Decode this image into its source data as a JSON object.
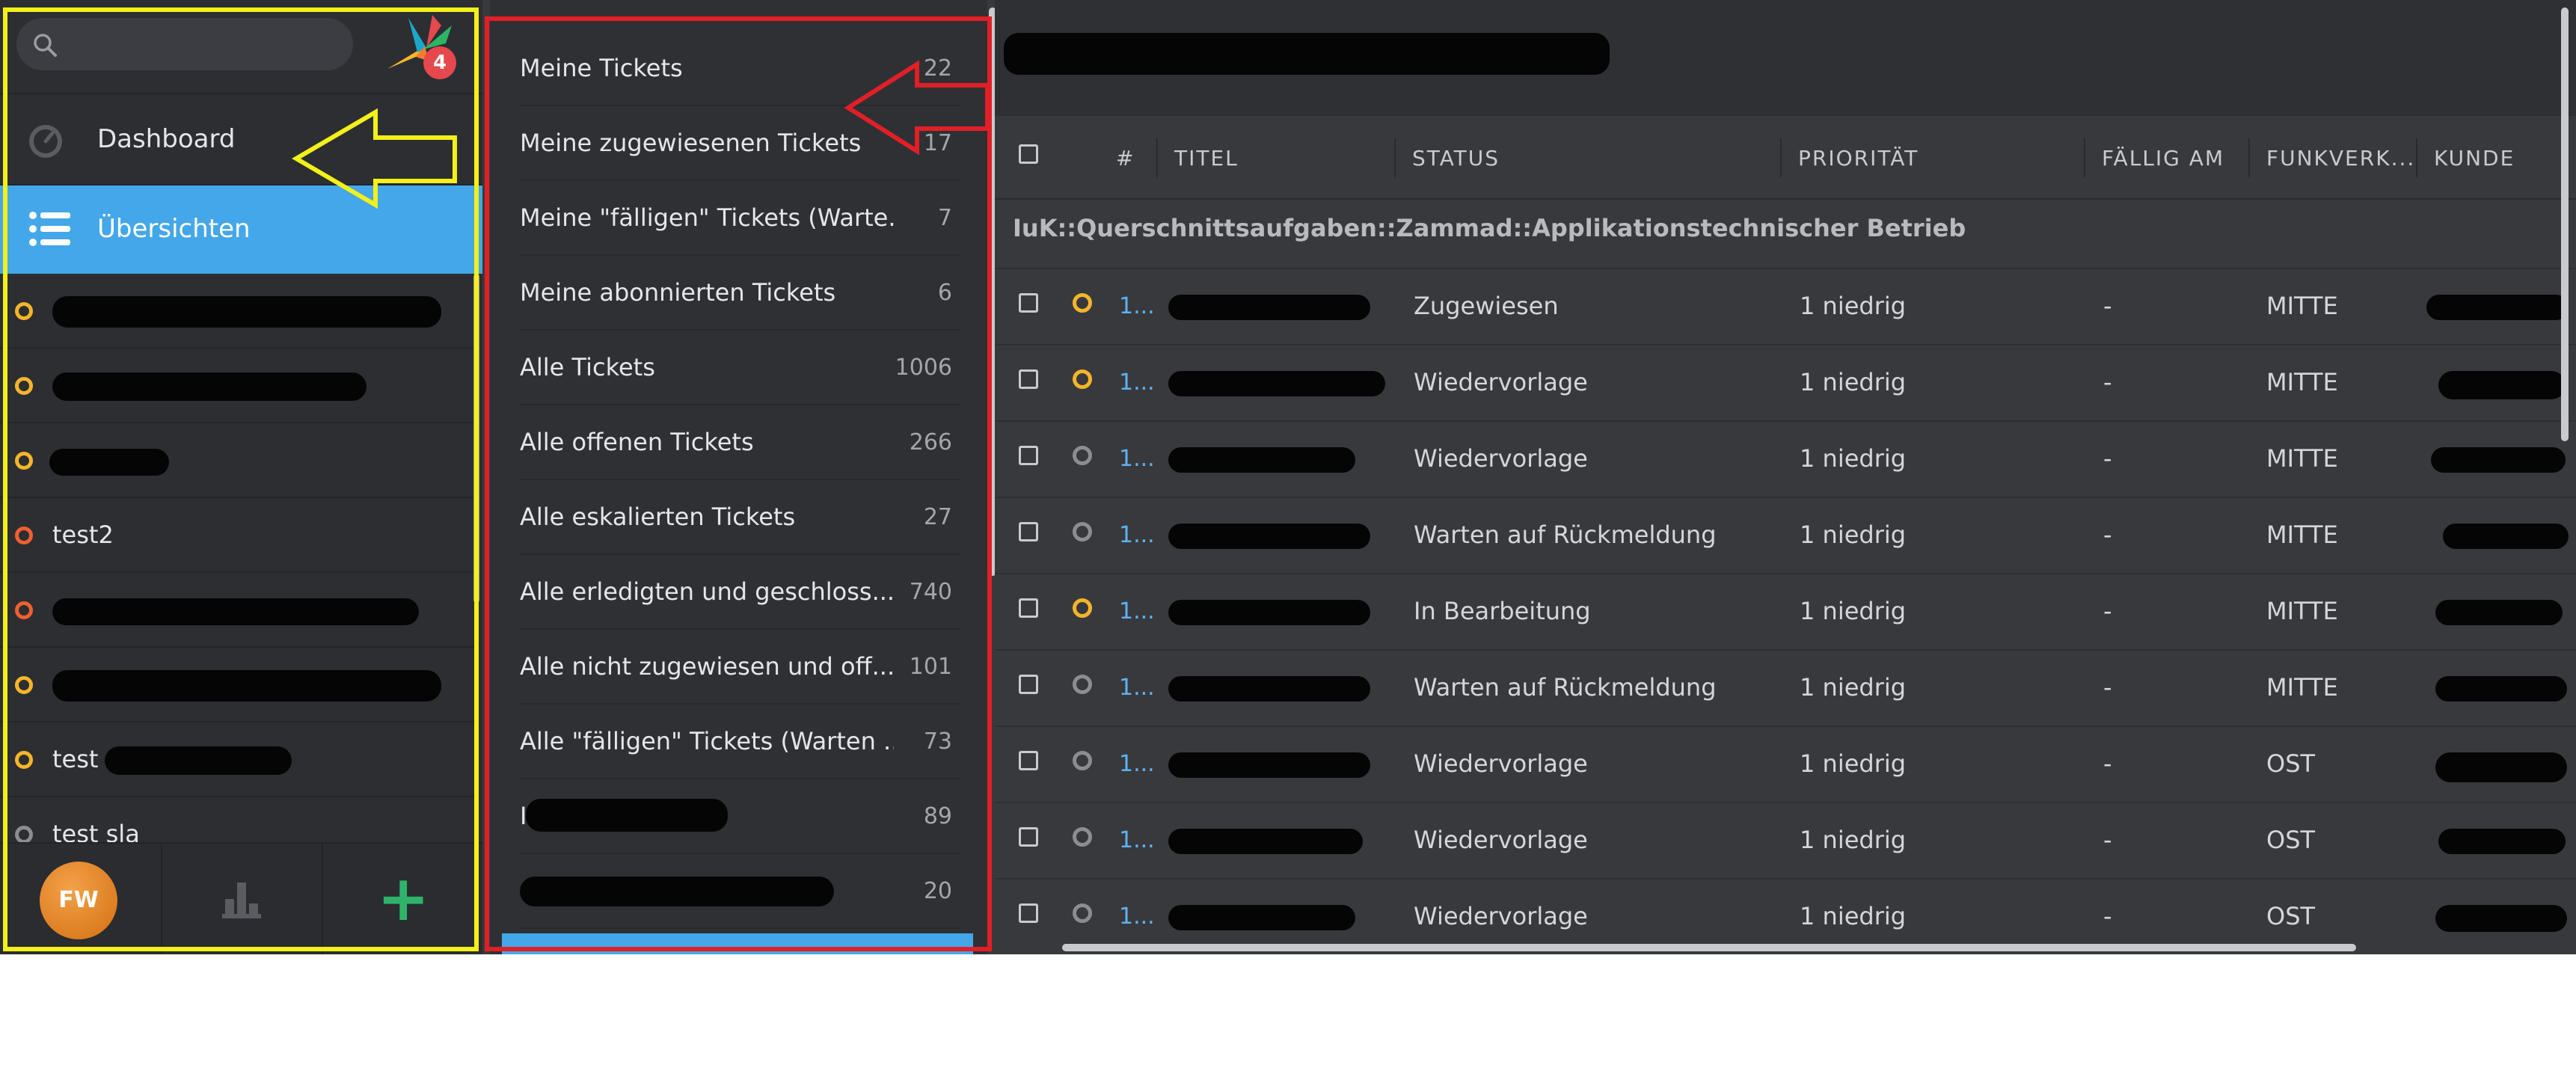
{
  "search": {
    "placeholder": ""
  },
  "logo": {
    "badge": "4"
  },
  "nav": {
    "dashboard": "Dashboard",
    "overviews": "Übersichten",
    "items": [
      {
        "label": "",
        "color": "orange"
      },
      {
        "label": "",
        "color": "orange"
      },
      {
        "label": "",
        "color": "orange"
      },
      {
        "label": "test2",
        "color": "red"
      },
      {
        "label": "",
        "color": "red"
      },
      {
        "label": "",
        "color": "orange"
      },
      {
        "label": "test",
        "color": "orange"
      },
      {
        "label": "test sla",
        "color": "grey"
      }
    ],
    "avatar": "FW",
    "add": "+"
  },
  "overviews": [
    {
      "label": "Meine Tickets",
      "count": "22"
    },
    {
      "label": "Meine zugewiesenen Tickets",
      "count": "17"
    },
    {
      "label": "Meine \"fälligen\" Tickets (Warte...",
      "count": "7"
    },
    {
      "label": "Meine abonnierten Tickets",
      "count": "6"
    },
    {
      "label": "Alle Tickets",
      "count": "1006"
    },
    {
      "label": "Alle offenen Tickets",
      "count": "266"
    },
    {
      "label": "Alle eskalierten Tickets",
      "count": "27"
    },
    {
      "label": "Alle erledigten und geschloss...",
      "count": "740"
    },
    {
      "label": "Alle nicht zugewiesen und off...",
      "count": "101"
    },
    {
      "label": "Alle \"fälligen\" Tickets (Warten ...",
      "count": "73"
    },
    {
      "label": "I",
      "count": "89"
    },
    {
      "label": "",
      "count": "20"
    }
  ],
  "table": {
    "headers": {
      "num": "#",
      "title": "TITEL",
      "status": "STATUS",
      "priority": "PRIORITÄT",
      "due": "FÄLLIG AM",
      "funk": "FUNKVERK...",
      "customer": "KUNDE"
    },
    "group": "IuK::Querschnittsaufgaben::Zammad::Applikationstechnischer Betrieb",
    "rows": [
      {
        "num": "1...",
        "title": "",
        "status": "Zugewiesen",
        "priority": "1 niedrig",
        "due": "-",
        "funk": "MITTE",
        "dot": "orange"
      },
      {
        "num": "1...",
        "title": "",
        "status": "Wiedervorlage",
        "priority": "1 niedrig",
        "due": "-",
        "funk": "MITTE",
        "dot": "orange"
      },
      {
        "num": "1...",
        "title": "",
        "status": "Wiedervorlage",
        "priority": "1 niedrig",
        "due": "-",
        "funk": "MITTE",
        "dot": "grey"
      },
      {
        "num": "1...",
        "title": "",
        "status": "Warten auf Rückmeldung",
        "priority": "1 niedrig",
        "due": "-",
        "funk": "MITTE",
        "dot": "grey"
      },
      {
        "num": "1...",
        "title": "",
        "status": "In Bearbeitung",
        "priority": "1 niedrig",
        "due": "-",
        "funk": "MITTE",
        "dot": "orange"
      },
      {
        "num": "1...",
        "title": "",
        "status": "Warten auf Rückmeldung",
        "priority": "1 niedrig",
        "due": "-",
        "funk": "MITTE",
        "dot": "grey"
      },
      {
        "num": "1...",
        "title": "",
        "status": "Wiedervorlage",
        "priority": "1 niedrig",
        "due": "-",
        "funk": "OST",
        "dot": "grey"
      },
      {
        "num": "1...",
        "title": "",
        "status": "Wiedervorlage",
        "priority": "1 niedrig",
        "due": "-",
        "funk": "OST",
        "dot": "grey"
      },
      {
        "num": "1...",
        "title": "",
        "status": "Wiedervorlage",
        "priority": "1 niedrig",
        "due": "-",
        "funk": "OST",
        "dot": "grey"
      }
    ]
  },
  "colors": {
    "accent": "#44a7e9",
    "status_orange": "#f5b52a",
    "status_red": "#f0602e",
    "status_grey": "#8b8d92",
    "annotation_yellow": "#f3f01a",
    "annotation_red": "#e21f26"
  }
}
